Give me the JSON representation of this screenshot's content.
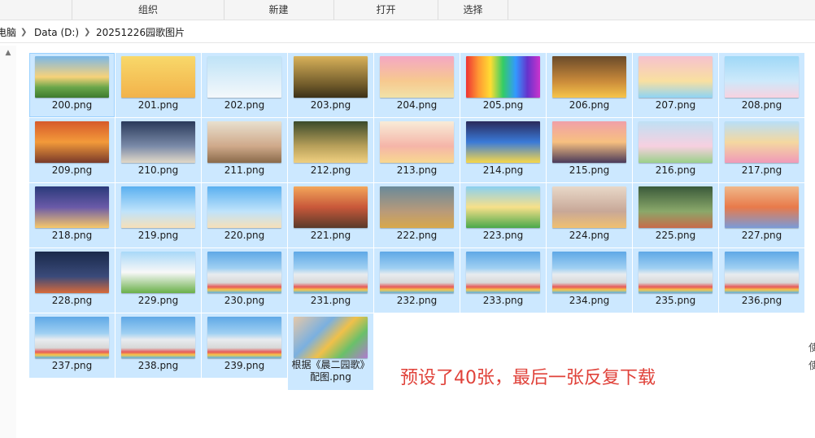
{
  "ribbon": {
    "groups": [
      "组织",
      "新建",
      "打开",
      "选择"
    ]
  },
  "address": {
    "crumbs": [
      "电脑",
      "Data (D:)",
      "20251226园歌图片"
    ]
  },
  "files": [
    {
      "name": "200.png",
      "icon": "sunrise-landscape-thumbnail"
    },
    {
      "name": "201.png",
      "icon": "cartoon-child-thumbnail"
    },
    {
      "name": "202.png",
      "icon": "flying-children-thumbnail"
    },
    {
      "name": "203.png",
      "icon": "tree-sprout-thumbnail"
    },
    {
      "name": "204.png",
      "icon": "rainbow-cloud-thumbnail"
    },
    {
      "name": "205.png",
      "icon": "rainbow-kids-row-thumbnail"
    },
    {
      "name": "206.png",
      "icon": "laughing-kids-thumbnail"
    },
    {
      "name": "207.png",
      "icon": "rainbow-slide-thumbnail"
    },
    {
      "name": "208.png",
      "icon": "rainbow-balloons-thumbnail"
    },
    {
      "name": "209.png",
      "icon": "sunset-kids-thumbnail"
    },
    {
      "name": "210.png",
      "icon": "cloud-sparkles-thumbnail"
    },
    {
      "name": "211.png",
      "icon": "painting-kids-thumbnail"
    },
    {
      "name": "212.png",
      "icon": "fairy-garden-thumbnail"
    },
    {
      "name": "213.png",
      "icon": "reading-kids-thumbnail"
    },
    {
      "name": "214.png",
      "icon": "dance-stage-thumbnail"
    },
    {
      "name": "215.png",
      "icon": "rainbow-silhouettes-thumbnail"
    },
    {
      "name": "216.png",
      "icon": "cartoon-pair-thumbnail"
    },
    {
      "name": "217.png",
      "icon": "playground-thumbnail"
    },
    {
      "name": "218.png",
      "icon": "moon-rocket-thumbnail"
    },
    {
      "name": "219.png",
      "icon": "balloon-sky-thumbnail"
    },
    {
      "name": "220.png",
      "icon": "balloon-sky-2-thumbnail"
    },
    {
      "name": "221.png",
      "icon": "school-building-thumbnail"
    },
    {
      "name": "222.png",
      "icon": "backpacks-thumbnail"
    },
    {
      "name": "223.png",
      "icon": "rainbow-arch-thumbnail"
    },
    {
      "name": "224.png",
      "icon": "paint-splash-thumbnail"
    },
    {
      "name": "225.png",
      "icon": "rain-umbrellas-thumbnail"
    },
    {
      "name": "227.png",
      "icon": "handprint-wall-thumbnail"
    },
    {
      "name": "228.png",
      "icon": "night-lanterns-thumbnail"
    },
    {
      "name": "229.png",
      "icon": "school-gate-thumbnail"
    },
    {
      "name": "230.png",
      "icon": "graduation-thumbnail"
    },
    {
      "name": "231.png",
      "icon": "graduation-thumbnail"
    },
    {
      "name": "232.png",
      "icon": "graduation-thumbnail"
    },
    {
      "name": "233.png",
      "icon": "graduation-thumbnail"
    },
    {
      "name": "234.png",
      "icon": "graduation-thumbnail"
    },
    {
      "name": "235.png",
      "icon": "graduation-thumbnail"
    },
    {
      "name": "236.png",
      "icon": "graduation-thumbnail"
    },
    {
      "name": "237.png",
      "icon": "graduation-thumbnail"
    },
    {
      "name": "238.png",
      "icon": "graduation-thumbnail"
    },
    {
      "name": "239.png",
      "icon": "graduation-thumbnail"
    },
    {
      "name": "根据《晨二园歌》配图.png",
      "icon": "puzzle-pieces-thumbnail"
    }
  ],
  "note": "预设了40张，最后一张反复下载",
  "edge_text": [
    "使",
    "使"
  ],
  "colors": {
    "selection": "#cce8ff",
    "annotation": "#e0423a"
  }
}
